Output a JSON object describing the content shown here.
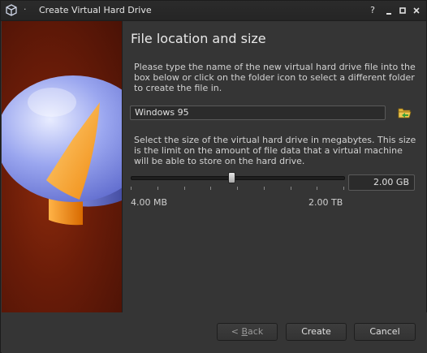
{
  "window": {
    "title": "Create Virtual Hard Drive",
    "title_separator": "·",
    "help_button": "?",
    "minimize_button": "–",
    "maximize_button": "▢",
    "close_button": "✕",
    "app_icon": "virtualbox-cube-icon"
  },
  "side_image": {
    "icon": "hard-disk-pie-illustration-icon"
  },
  "page": {
    "title": "File location and size",
    "location_instructions": "Please type the name of the new virtual hard drive file into the box below or click on the folder icon to select a different folder to create the file in.",
    "file_name_value": "Windows 95",
    "folder_icon": "folder-open-icon",
    "size_instructions": "Select the size of the virtual hard drive in megabytes. This size is the limit on the amount of file data that a virtual machine will be able to store on the hard drive.",
    "size_value": "2.00 GB",
    "slider_position_fraction": 0.475,
    "min_label": "4.00 MB",
    "max_label": "2.00 TB"
  },
  "buttons": {
    "back_prefix": "< ",
    "back_mnemonic": "B",
    "back_rest": "ack",
    "create_label": "Create",
    "cancel_label": "Cancel"
  },
  "colors": {
    "window_bg": "#353535",
    "image_bg": "#6a1c08",
    "pie_blue": "#6f7fd8",
    "pie_orange": "#f5a623"
  }
}
